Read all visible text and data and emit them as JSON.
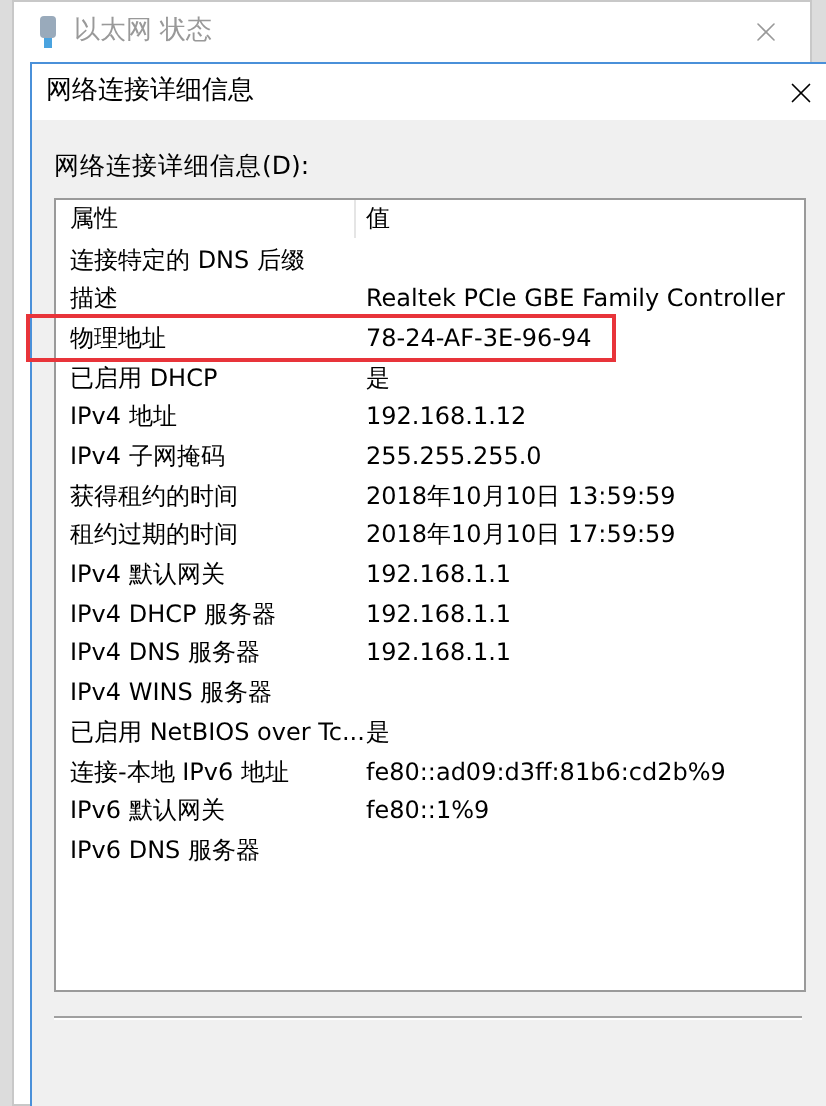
{
  "background_window": {
    "title": "以太网 状态"
  },
  "dialog": {
    "title": "网络连接详细信息",
    "list_label": "网络连接详细信息(D):",
    "columns": [
      "属性",
      "值"
    ],
    "rows": [
      {
        "property": "连接特定的 DNS 后缀",
        "value": "",
        "highlighted": false
      },
      {
        "property": "描述",
        "value": "Realtek PCIe GBE Family Controller",
        "highlighted": false
      },
      {
        "property": "物理地址",
        "value": "78-24-AF-3E-96-94",
        "highlighted": true
      },
      {
        "property": "已启用 DHCP",
        "value": "是",
        "highlighted": false
      },
      {
        "property": "IPv4 地址",
        "value": "192.168.1.12",
        "highlighted": false
      },
      {
        "property": "IPv4 子网掩码",
        "value": "255.255.255.0",
        "highlighted": false
      },
      {
        "property": "获得租约的时间",
        "value": "2018年10月10日 13:59:59",
        "highlighted": false
      },
      {
        "property": "租约过期的时间",
        "value": "2018年10月10日 17:59:59",
        "highlighted": false
      },
      {
        "property": "IPv4 默认网关",
        "value": "192.168.1.1",
        "highlighted": false
      },
      {
        "property": "IPv4 DHCP 服务器",
        "value": "192.168.1.1",
        "highlighted": false
      },
      {
        "property": "IPv4 DNS 服务器",
        "value": "192.168.1.1",
        "highlighted": false
      },
      {
        "property": "IPv4 WINS 服务器",
        "value": "",
        "highlighted": false
      },
      {
        "property": "已启用 NetBIOS over Tc...",
        "value": "是",
        "highlighted": false
      },
      {
        "property": "连接-本地 IPv6 地址",
        "value": "fe80::ad09:d3ff:81b6:cd2b%9",
        "highlighted": false
      },
      {
        "property": "IPv6 默认网关",
        "value": "fe80::1%9",
        "highlighted": false
      },
      {
        "property": "IPv6 DNS 服务器",
        "value": "",
        "highlighted": false
      }
    ]
  }
}
